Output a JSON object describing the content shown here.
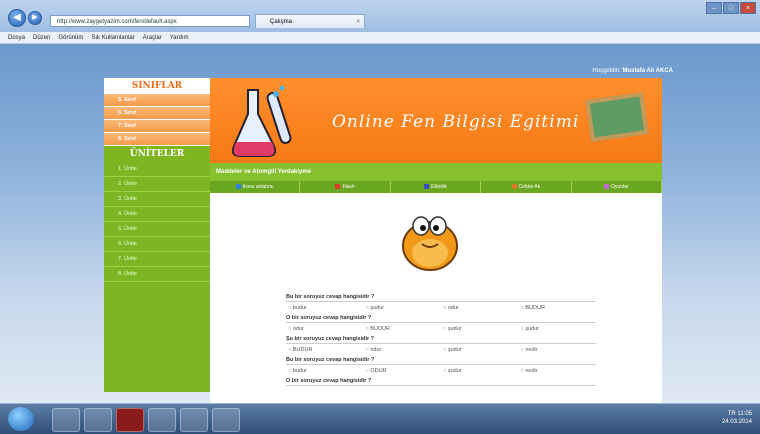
{
  "browser": {
    "address": "http://www.zaygetyazim.com/fen/default.aspx",
    "tab_title": "Çalışma",
    "menu": [
      "Dosya",
      "Düzen",
      "Görünüm",
      "Sık Kullanılanlar",
      "Araçlar",
      "Yardım"
    ]
  },
  "page": {
    "user_label": "Hoşgeldin:",
    "user_name": "Mustafa Ali AKCA",
    "banner_title": "Online Fen Bilgisi Egitimi",
    "section_title": "Maddeler ve Atomgill Yerdakiyme",
    "classes_header": "SINIFLAR",
    "classes": [
      "5. Sınıf",
      "6. Sınıf",
      "7. Sınıf",
      "8. Sınıf"
    ],
    "units_header": "ÜNİTELER",
    "units": [
      "1. Ünite",
      "2. Ünite",
      "3. Ünite",
      "4. Ünite",
      "5. Ünite",
      "6. Ünite",
      "7. Ünite",
      "8. Ünite"
    ],
    "nav": [
      {
        "label": "Konu anlatımı",
        "color": "#2f7de0"
      },
      {
        "label": "Flash",
        "color": "#e03a2f"
      },
      {
        "label": "Etkinlik",
        "color": "#3b49c9"
      },
      {
        "label": "Cebire Ak",
        "color": "#e07a2f"
      },
      {
        "label": "Oyunlar",
        "color": "#c06bd4"
      }
    ]
  },
  "quiz": [
    {
      "question": "Bu bir soruyuz cevap hangisidir ?",
      "options": [
        "budur",
        "şudur",
        "odur",
        "BUDUR"
      ]
    },
    {
      "question": "O bir soruyuz cevap hangisidir ?",
      "options": [
        "odur",
        "BUDUR",
        "şudur",
        "şudur"
      ]
    },
    {
      "question": "Şu bir soruyuz cevap hangisidir ?",
      "options": [
        "BUDUR",
        "odur",
        "şudur",
        "nedir"
      ]
    },
    {
      "question": "Bu bir soruyuz cevap hangisidir ?",
      "options": [
        "budur",
        "ODUR",
        "şudur",
        "nedir"
      ]
    },
    {
      "question": "O bir soruyuz cevap hangisidir ?",
      "options": []
    }
  ],
  "taskbar": {
    "time": "11:05",
    "date": "24.03.2014",
    "lang": "TR"
  },
  "colors": {
    "orange": "#f77a16",
    "green": "#7cb625"
  }
}
